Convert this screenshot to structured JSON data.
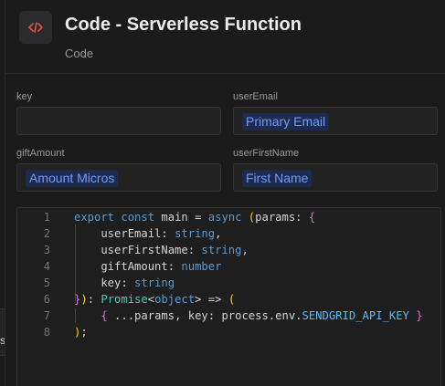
{
  "header": {
    "icon": "code-brackets-icon",
    "title": "Code - Serverless Function",
    "subtitle": "Code"
  },
  "fields": {
    "key": {
      "label": "key",
      "value": ""
    },
    "userEmail": {
      "label": "userEmail",
      "chip": "Primary Email"
    },
    "giftAmount": {
      "label": "giftAmount",
      "chip": "Amount Micros"
    },
    "userFirstName": {
      "label": "userFirstName",
      "chip": "First Name"
    }
  },
  "code": {
    "line_numbers": [
      "1",
      "2",
      "3",
      "4",
      "5",
      "6",
      "7",
      "8"
    ],
    "lines": [
      "export const main = async (params: {",
      "    userEmail: string,",
      "    userFirstName: string,",
      "    giftAmount: number",
      "    key: string",
      "}): Promise<object> => (",
      "    { ...params, key: process.env.SENDGRID_API_KEY }",
      ");"
    ]
  },
  "background": {
    "edge_text": "s"
  },
  "colors": {
    "background": "#1b1b1b",
    "chip_bg": "#1f2b4c",
    "chip_text": "#6d9cff",
    "accent_icon": "#e2514a"
  }
}
